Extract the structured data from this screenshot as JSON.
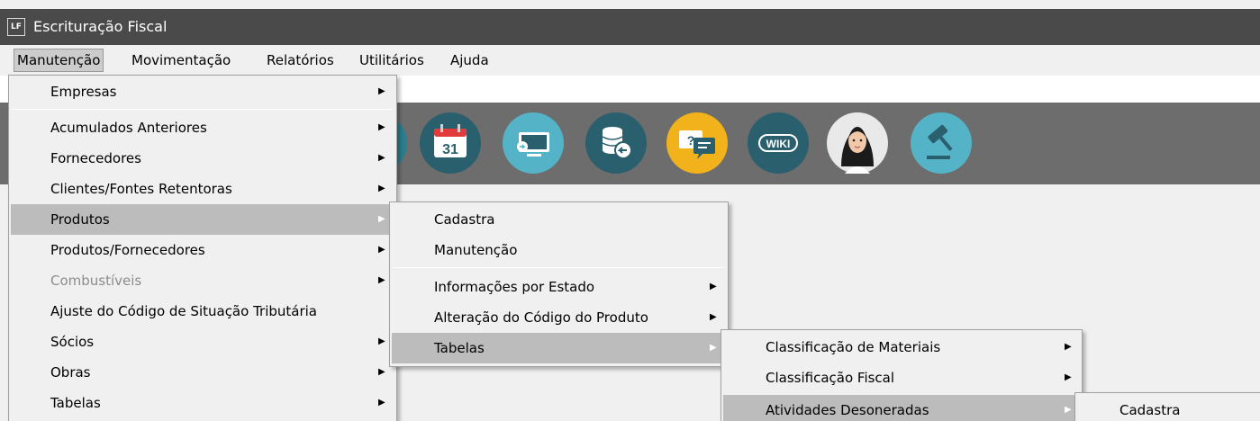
{
  "window": {
    "icon_label": "LF",
    "title": "Escrituração Fiscal"
  },
  "menubar": {
    "items": [
      {
        "label": "Manutenção"
      },
      {
        "label": "Movimentação"
      },
      {
        "label": "Relatórios"
      },
      {
        "label": "Utilitários"
      },
      {
        "label": "Ajuda"
      }
    ]
  },
  "toolbar": {
    "icons": [
      "calendar-31-icon",
      "screen-transfer-icon",
      "database-arrow-icon",
      "help-chat-icon",
      "wiki-icon",
      "assistant-avatar-icon",
      "legal-gavel-icon"
    ],
    "calendar_day": "31",
    "wiki_label": "WIKI",
    "help_label": "?"
  },
  "menu_manutencao": {
    "items": [
      {
        "label": "Empresas",
        "submenu": true
      },
      {
        "label": "Acumulados Anteriores",
        "submenu": true
      },
      {
        "label": "Fornecedores",
        "submenu": true
      },
      {
        "label": "Clientes/Fontes Retentoras",
        "submenu": true
      },
      {
        "label": "Produtos",
        "submenu": true,
        "highlighted": true
      },
      {
        "label": "Produtos/Fornecedores",
        "submenu": true
      },
      {
        "label": "Combustíveis",
        "submenu": true,
        "disabled": true
      },
      {
        "label": "Ajuste do Código de Situação Tributária",
        "submenu": false
      },
      {
        "label": "Sócios",
        "submenu": true
      },
      {
        "label": "Obras",
        "submenu": true
      },
      {
        "label": "Tabelas",
        "submenu": true
      }
    ]
  },
  "menu_produtos": {
    "items": [
      {
        "label": "Cadastra",
        "submenu": false
      },
      {
        "label": "Manutenção",
        "submenu": false
      },
      {
        "label": "Informações por Estado",
        "submenu": true
      },
      {
        "label": "Alteração do Código do Produto",
        "submenu": true
      },
      {
        "label": "Tabelas",
        "submenu": true,
        "highlighted": true
      }
    ]
  },
  "menu_tabelas": {
    "items": [
      {
        "label": "Classificação de Materiais",
        "submenu": true
      },
      {
        "label": "Classificação Fiscal",
        "submenu": true
      },
      {
        "label": "Atividades Desoneradas",
        "submenu": true,
        "highlighted": true
      }
    ]
  },
  "menu_atividades": {
    "items": [
      {
        "label": "Cadastra",
        "submenu": false
      }
    ]
  },
  "colors": {
    "titlebar": "#4a4a4a",
    "toolbar": "#6d6d6d",
    "menu_background": "#f0f0f0",
    "highlight": "#bcbcbc",
    "icon_dark_teal": "#2a5f6e",
    "icon_light_teal": "#54b3c6",
    "icon_yellow": "#f2b21c"
  }
}
